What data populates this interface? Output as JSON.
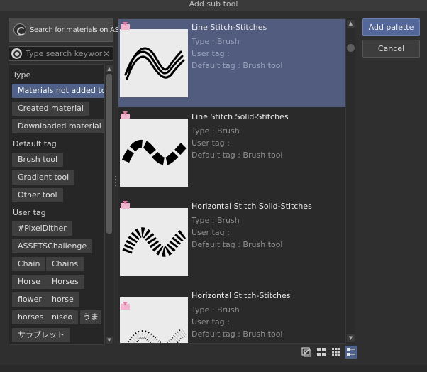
{
  "window": {
    "title": "Add sub tool"
  },
  "left_panel": {
    "assets_button_label": "Search for materials on ASSETS",
    "search_placeholder": "Type search keywor...",
    "sections": [
      {
        "title": "Type",
        "chips": [
          "Materials not added to pa",
          "Created material",
          "Downloaded material"
        ]
      },
      {
        "title": "Default tag",
        "chips": [
          "Brush tool",
          "Gradient tool",
          "Other tool"
        ]
      },
      {
        "title": "User tag",
        "chips": [
          "#PixelDither",
          "ASSETSChallenge",
          "Chain",
          "Chains",
          "Horse",
          "Horses",
          "flower",
          "horse",
          "horses",
          "niseo",
          "うま",
          "サラブレット"
        ]
      }
    ]
  },
  "materials": [
    {
      "name": "Line Stitch-Stitches",
      "type": "Type : Brush",
      "user_tag": "User tag :",
      "default_tag": "Default tag : Brush tool",
      "selected": true
    },
    {
      "name": "Line Stitch Solid-Stitches",
      "type": "Type : Brush",
      "user_tag": "User tag :",
      "default_tag": "Default tag : Brush tool",
      "selected": false
    },
    {
      "name": "Horizontal Stitch Solid-Stitches",
      "type": "Type : Brush",
      "user_tag": "User tag :",
      "default_tag": "Default tag : Brush tool",
      "selected": false
    },
    {
      "name": "Horizontal Stitch-Stitches",
      "type": "Type : Brush",
      "user_tag": "User tag :",
      "default_tag": "Default tag : Brush tool",
      "selected": false
    }
  ],
  "buttons": {
    "add_palette": "Add palette",
    "cancel": "Cancel"
  },
  "view_modes": [
    "checkbox-icon",
    "grid-large-icon",
    "grid-small-icon",
    "list-detail-icon"
  ],
  "colors": {
    "selection": "#525c7e",
    "primary_button": "#54679a",
    "selected_chip": "#50628a"
  }
}
